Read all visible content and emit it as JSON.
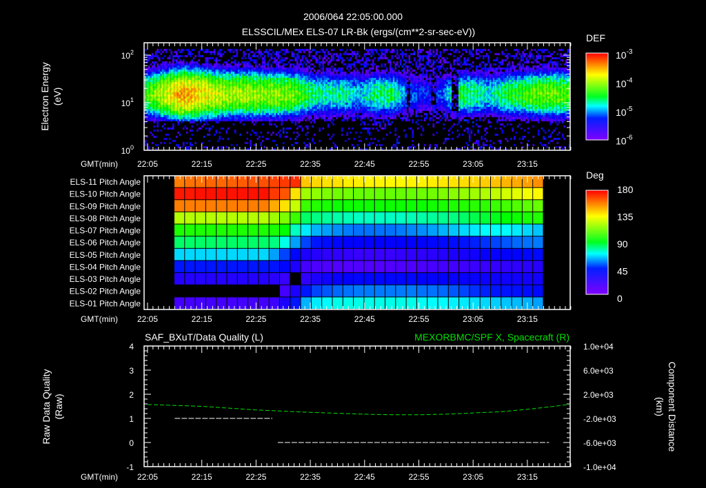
{
  "header": {
    "timestamp": "2006/064 22:05:00.000"
  },
  "chart_data": [
    {
      "type": "heatmap",
      "title": "ELSSCIL/MEx ELS-07 LR-Bk  (ergs/(cm**2-sr-sec-eV))",
      "ylabel": [
        "Electron Energy",
        "(eV)"
      ],
      "xlabel": "GMT(min)",
      "x_ticks": [
        "22:05",
        "22:15",
        "22:25",
        "22:35",
        "22:45",
        "22:55",
        "23:05",
        "23:15"
      ],
      "y_scale": "log",
      "y_ticks": [
        {
          "base": "10",
          "exp": "2"
        },
        {
          "base": "10",
          "exp": "1"
        },
        {
          "base": "10",
          "exp": "0"
        }
      ],
      "ylim_eV": [
        1,
        180
      ],
      "colorbar": {
        "title": "DEF",
        "labels": [
          {
            "base": "10",
            "exp": "-3"
          },
          {
            "base": "10",
            "exp": "-4"
          },
          {
            "base": "10",
            "exp": "-5"
          },
          {
            "base": "10",
            "exp": "-6"
          }
        ],
        "range_log10": [
          -6,
          -3
        ]
      },
      "band_peak_log10_def": {
        "minutes_after_2205": [
          0,
          3,
          6,
          9,
          12,
          15,
          18,
          21,
          24,
          27,
          30,
          33,
          36,
          39,
          42,
          45,
          48,
          51,
          54,
          57,
          60,
          63,
          66,
          69,
          72,
          75,
          78
        ],
        "values": [
          -4.3,
          -3.9,
          -3.5,
          -3.6,
          -3.9,
          -4.0,
          -4.0,
          -4.1,
          -4.1,
          -4.2,
          -4.6,
          -4.7,
          -4.7,
          -4.9,
          -4.6,
          -4.6,
          -5.1,
          -5.3,
          -5.2,
          -4.5,
          -4.6,
          -4.8,
          -4.5,
          -4.4,
          -4.2,
          -4.2,
          -4.3
        ]
      },
      "low_energy_cutoff_eV": {
        "default": 4.3,
        "dips": [
          {
            "from": 27,
            "to": 29,
            "eV": 3.0
          },
          {
            "from": 39,
            "to": 44,
            "eV": 3.0
          }
        ]
      },
      "data_gaps_minutes": [
        [
          47.5,
          48.3
        ],
        [
          52,
          53
        ],
        [
          56,
          57
        ]
      ]
    },
    {
      "type": "heatmap",
      "title": "Pitch Angle",
      "xlabel": "GMT(min)",
      "x_ticks": [
        "22:05",
        "22:15",
        "22:25",
        "22:35",
        "22:45",
        "22:55",
        "23:05",
        "23:15"
      ],
      "rows": [
        "ELS-11 Pitch Angle",
        "ELS-10 Pitch Angle",
        "ELS-09 Pitch Angle",
        "ELS-08 Pitch Angle",
        "ELS-07 Pitch Angle",
        "ELS-06 Pitch Angle",
        "ELS-05 Pitch Angle",
        "ELS-04 Pitch Angle",
        "ELS-03 Pitch Angle",
        "ELS-02 Pitch Angle",
        "ELS-01 Pitch Angle"
      ],
      "colorbar": {
        "title": "Deg",
        "labels": [
          "180",
          "135",
          "90",
          "45",
          "0"
        ],
        "range": [
          0,
          180
        ]
      },
      "values_deg": [
        [
          158,
          160,
          160,
          162,
          162,
          163,
          164,
          165,
          166,
          168,
          170,
          172,
          145,
          142,
          140,
          140,
          138,
          138,
          137,
          137,
          136,
          136,
          137,
          137,
          138,
          139,
          140,
          141,
          142,
          144,
          146,
          148,
          150,
          152,
          155
        ],
        [
          176,
          176,
          177,
          177,
          177,
          177,
          177,
          177,
          177,
          170,
          165,
          140,
          118,
          115,
          112,
          110,
          110,
          108,
          108,
          108,
          108,
          108,
          108,
          109,
          110,
          112,
          114,
          116,
          118,
          121,
          124,
          127,
          130,
          133,
          136
        ],
        [
          158,
          158,
          158,
          158,
          158,
          158,
          158,
          158,
          158,
          150,
          140,
          125,
          100,
          96,
          94,
          92,
          92,
          92,
          92,
          92,
          92,
          92,
          92,
          92,
          93,
          94,
          95,
          96,
          97,
          98,
          100,
          102,
          104,
          106,
          108
        ],
        [
          122,
          122,
          122,
          122,
          122,
          122,
          122,
          122,
          122,
          118,
          112,
          100,
          82,
          80,
          78,
          77,
          76,
          75,
          75,
          75,
          75,
          75,
          76,
          77,
          78,
          79,
          80,
          82,
          84,
          86,
          88,
          90,
          92,
          94,
          96
        ],
        [
          95,
          95,
          95,
          95,
          95,
          95,
          95,
          95,
          95,
          94,
          90,
          75,
          68,
          62,
          60,
          58,
          56,
          55,
          55,
          55,
          55,
          56,
          57,
          58,
          60,
          62,
          64,
          66,
          68,
          70,
          70,
          70,
          68,
          66,
          64
        ],
        [
          82,
          82,
          82,
          82,
          82,
          82,
          82,
          82,
          82,
          80,
          72,
          60,
          50,
          45,
          42,
          40,
          39,
          38,
          38,
          38,
          38,
          38,
          38,
          39,
          40,
          41,
          42,
          44,
          46,
          48,
          50,
          52,
          54,
          55,
          56
        ],
        [
          66,
          66,
          66,
          66,
          66,
          66,
          66,
          66,
          66,
          60,
          50,
          40,
          30,
          27,
          25,
          24,
          23,
          22,
          22,
          22,
          22,
          23,
          24,
          25,
          26,
          28,
          30,
          32,
          34,
          36,
          37,
          38,
          39,
          40,
          41
        ],
        [
          45,
          45,
          45,
          45,
          45,
          45,
          45,
          45,
          45,
          44,
          40,
          30,
          18,
          16,
          15,
          14,
          14,
          14,
          14,
          14,
          14,
          15,
          15,
          16,
          17,
          18,
          19,
          20,
          21,
          22,
          23,
          24,
          25,
          26,
          27
        ],
        [
          28,
          28,
          28,
          28,
          28,
          28,
          28,
          28,
          28,
          26,
          22,
          null,
          24,
          30,
          34,
          36,
          38,
          40,
          40,
          40,
          40,
          40,
          40,
          39,
          38,
          38,
          37,
          36,
          36,
          35,
          35,
          34,
          34,
          33,
          33
        ],
        [
          null,
          null,
          null,
          null,
          null,
          null,
          null,
          null,
          null,
          null,
          18,
          30,
          45,
          50,
          52,
          54,
          55,
          56,
          56,
          56,
          56,
          56,
          56,
          55,
          55,
          54,
          52,
          50,
          48,
          46,
          45,
          44,
          43,
          42,
          41
        ],
        [
          18,
          18,
          18,
          18,
          18,
          18,
          18,
          18,
          18,
          20,
          30,
          45,
          62,
          68,
          70,
          72,
          72,
          72,
          72,
          72,
          72,
          72,
          72,
          71,
          70,
          70,
          69,
          68,
          67,
          66,
          65,
          64,
          63,
          62,
          60
        ]
      ],
      "column_start_minute": 5.0,
      "column_step_minutes": 1.95
    },
    {
      "type": "line",
      "title_left": "SAF_BXuT/Data Quality (L)",
      "title_right": "MEXORBMC/SPF X, Spacecraft (R)",
      "ylabel_left": [
        "Raw Data Quality",
        "(Raw)"
      ],
      "ylabel_right": [
        "Component Distance",
        "(km)"
      ],
      "xlabel": "GMT(min)",
      "x_ticks": [
        "22:05",
        "22:15",
        "22:25",
        "22:35",
        "22:45",
        "22:55",
        "23:05",
        "23:15"
      ],
      "ylim_left": [
        -1,
        4
      ],
      "y_ticks_left": [
        "4",
        "3",
        "2",
        "1",
        "0",
        "-1"
      ],
      "ylim_right": [
        -10000,
        10000
      ],
      "y_ticks_right": [
        "1.0e+04",
        "6.0e+03",
        "2.0e+03",
        "-2.0e+03",
        "-6.0e+03",
        "-1.0e+04"
      ],
      "series": [
        {
          "name": "Data Quality",
          "axis": "left",
          "color": "#ffffff",
          "segments": [
            {
              "from_min": 5,
              "to_min": 23,
              "value": 1
            },
            {
              "from_min": 24,
              "to_min": 74,
              "value": 0
            }
          ]
        },
        {
          "name": "SPF X",
          "axis": "right",
          "color": "#00e000",
          "x_min": [
            0,
            10,
            20,
            30,
            40,
            45,
            50,
            55,
            60,
            65,
            70,
            75,
            78
          ],
          "values_km": [
            300,
            0,
            -600,
            -1000,
            -1300,
            -1400,
            -1400,
            -1300,
            -1100,
            -900,
            -500,
            0,
            350
          ]
        }
      ]
    }
  ]
}
